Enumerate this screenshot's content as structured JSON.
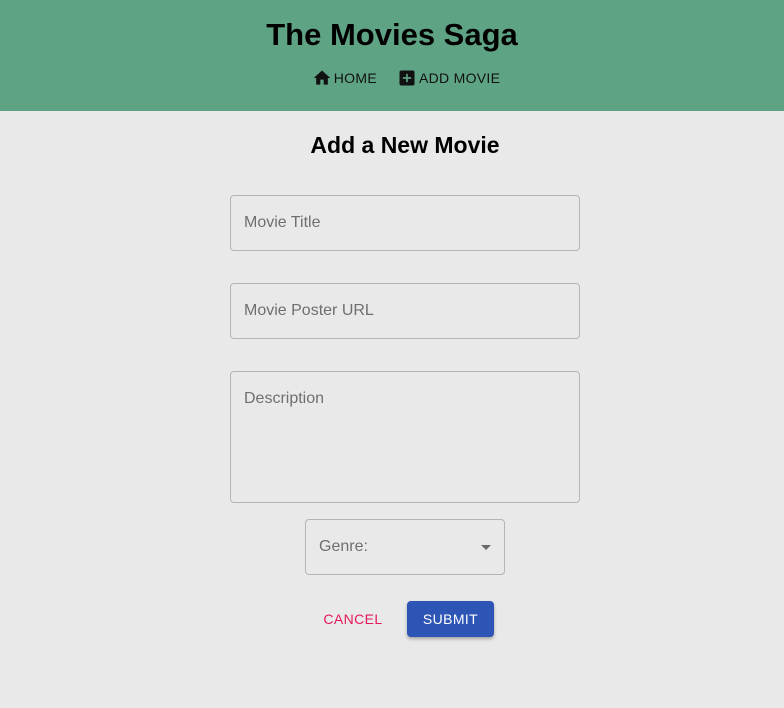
{
  "header": {
    "app_title": "The Movies Saga",
    "nav": [
      {
        "label": "HOME",
        "icon": "home-icon"
      },
      {
        "label": "ADD MOVIE",
        "icon": "add-box-icon"
      }
    ]
  },
  "form": {
    "page_title": "Add a New Movie",
    "title_placeholder": "Movie Title",
    "title_value": "",
    "poster_placeholder": "Movie Poster URL",
    "poster_value": "",
    "description_placeholder": "Description",
    "description_value": "",
    "genre_label": "Genre:",
    "genre_value": "",
    "cancel_label": "CANCEL",
    "submit_label": "SUBMIT"
  },
  "colors": {
    "header_bg": "#5fa385",
    "page_bg": "#e9e9e9",
    "cancel_text": "#e5195a",
    "submit_bg": "#2c55b5"
  }
}
